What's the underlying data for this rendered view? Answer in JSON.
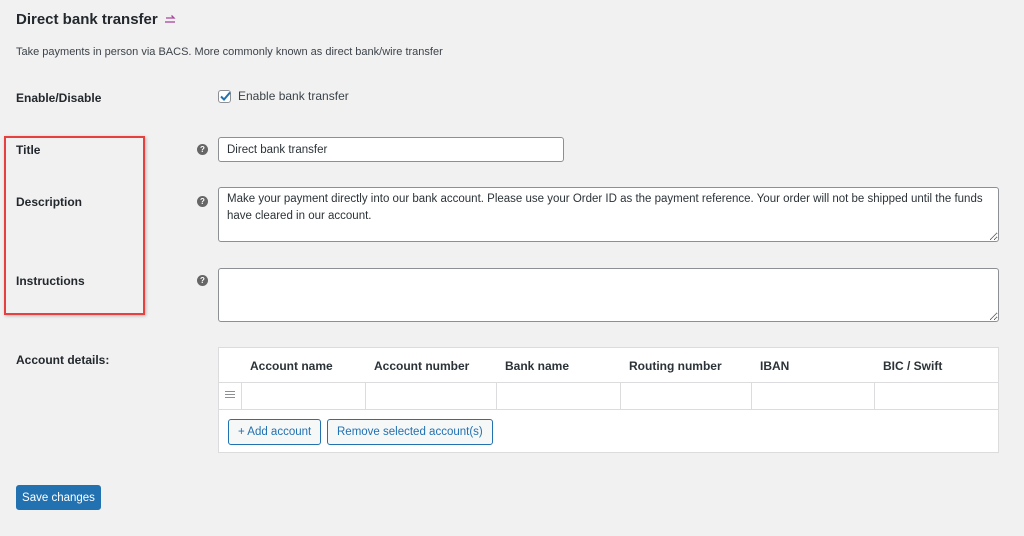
{
  "header": {
    "title": "Direct bank transfer",
    "return_icon": "return-arrow-icon",
    "intro": "Take payments in person via BACS. More commonly known as direct bank/wire transfer"
  },
  "fields": {
    "enable": {
      "label": "Enable/Disable",
      "checkbox_label": "Enable bank transfer",
      "checked": true
    },
    "title": {
      "label": "Title",
      "value": "Direct bank transfer"
    },
    "description": {
      "label": "Description",
      "value": "Make your payment directly into our bank account. Please use your Order ID as the payment reference. Your order will not be shipped until the funds have cleared in our account."
    },
    "instructions": {
      "label": "Instructions",
      "value": ""
    }
  },
  "accounts": {
    "label": "Account details:",
    "columns": [
      "Account name",
      "Account number",
      "Bank name",
      "Routing number",
      "IBAN",
      "BIC / Swift"
    ],
    "add_button": "+ Add account",
    "remove_button": "Remove selected account(s)"
  },
  "save_button": "Save changes",
  "colors": {
    "accent": "#2271b1",
    "highlight_box": "#e4413f",
    "background": "#f1f1f1"
  }
}
